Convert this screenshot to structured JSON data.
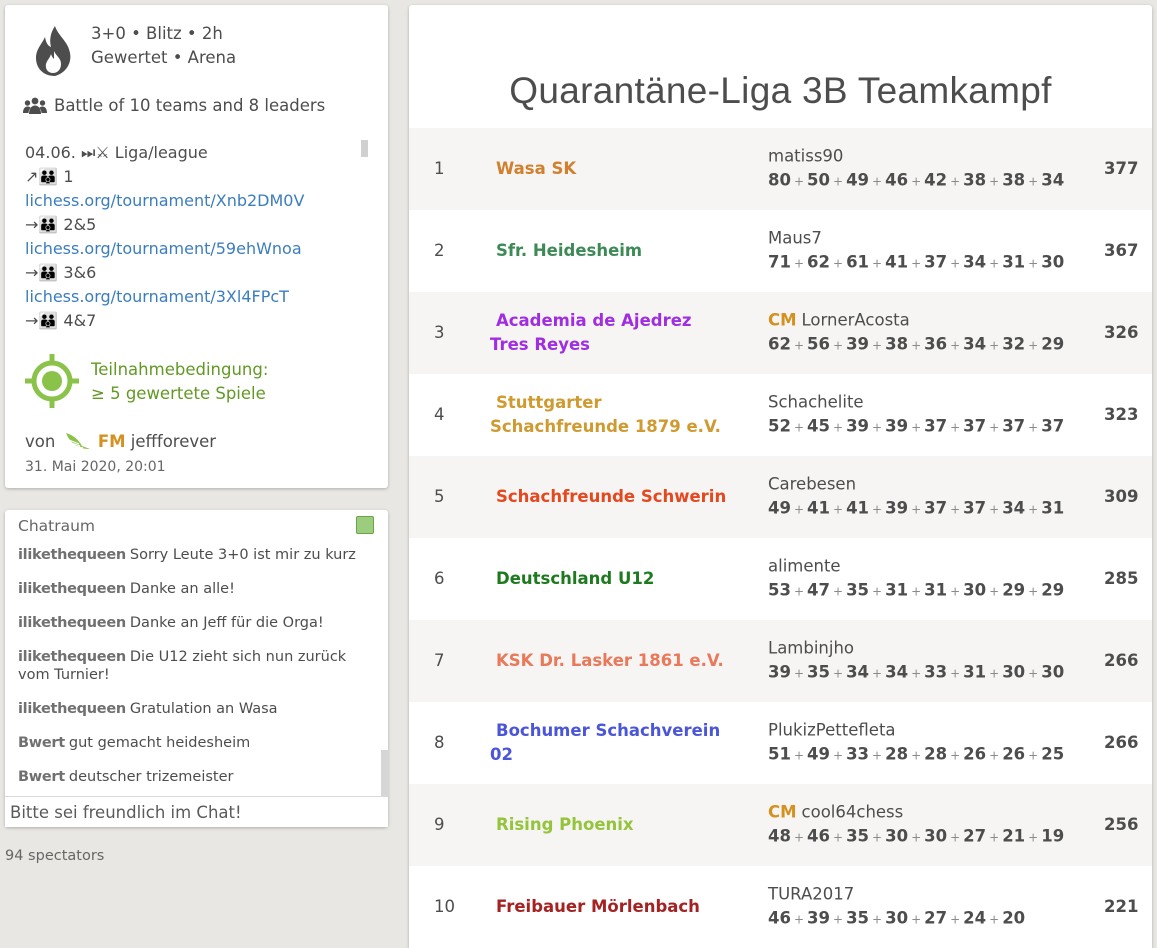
{
  "info": {
    "setup_line1": "3+0 • Blitz • 2h",
    "setup_line2": "Gewertet • Arena",
    "battle": "Battle of 10 teams and 8 leaders",
    "description": [
      {
        "text": "04.06. ⏭⚔ Liga/league",
        "link": false
      },
      {
        "text": "↗👪 1",
        "link": false
      },
      {
        "text": "lichess.org/tournament/Xnb2DM0V",
        "link": true
      },
      {
        "text": "→👪 2&5",
        "link": false
      },
      {
        "text": "lichess.org/tournament/59ehWnoa",
        "link": true
      },
      {
        "text": "→👪 3&6",
        "link": false
      },
      {
        "text": "lichess.org/tournament/3Xl4FPcT",
        "link": true
      },
      {
        "text": "→👪 4&7",
        "link": false
      }
    ],
    "condition_line1": "Teilnahmebedingung:",
    "condition_line2": "≥ 5 gewertete Spiele",
    "by_label": "von",
    "creator_title": "FM",
    "creator_name": "jeffforever",
    "created_date": "31. Mai 2020, 20:01",
    "colors": {
      "condition": "#629924",
      "title": "#d59120",
      "link": "#3b7dbd"
    }
  },
  "chat": {
    "title": "Chatraum",
    "messages": [
      {
        "user": "ilikethequeen",
        "text": "Sorry Leute 3+0 ist mir zu kurz"
      },
      {
        "user": "ilikethequeen",
        "text": "Danke an alle!"
      },
      {
        "user": "ilikethequeen",
        "text": "Danke an Jeff für die Orga!"
      },
      {
        "user": "ilikethequeen",
        "text": "Die U12 zieht sich nun zurück vom Turnier!"
      },
      {
        "user": "ilikethequeen",
        "text": "Gratulation an Wasa"
      },
      {
        "user": "Bwert",
        "text": "gut gemacht heidesheim"
      },
      {
        "user": "Bwert",
        "text": "deutscher trizemeister"
      }
    ],
    "input_placeholder": "Bitte sei freundlich im Chat!"
  },
  "spectators": "94 spectators",
  "main": {
    "title": "Quarantäne-Liga 3B Teamkampf",
    "standings": [
      {
        "rank": "1",
        "team": "Wasa SK",
        "color": "#d0802e",
        "cm": "",
        "leader": "matiss90",
        "scores": [
          "80",
          "50",
          "49",
          "46",
          "42",
          "38",
          "38",
          "34"
        ],
        "total": "377"
      },
      {
        "rank": "2",
        "team": "Sfr. Heidesheim",
        "color": "#3e8a57",
        "cm": "",
        "leader": "Maus7",
        "scores": [
          "71",
          "62",
          "61",
          "41",
          "37",
          "34",
          "31",
          "30"
        ],
        "total": "367"
      },
      {
        "rank": "3",
        "team": "Academia de Ajedrez Tres Reyes",
        "color": "#a02ee0",
        "cm": "CM",
        "leader": "LornerAcosta",
        "scores": [
          "62",
          "56",
          "39",
          "38",
          "36",
          "34",
          "32",
          "29"
        ],
        "total": "326"
      },
      {
        "rank": "4",
        "team": "Stuttgarter Schachfreunde 1879 e.V.",
        "color": "#cf9a30",
        "cm": "",
        "leader": "Schachelite",
        "scores": [
          "52",
          "45",
          "39",
          "39",
          "37",
          "37",
          "37",
          "37"
        ],
        "total": "323"
      },
      {
        "rank": "5",
        "team": "Schachfreunde Schwerin",
        "color": "#e5481f",
        "cm": "",
        "leader": "Carebesen",
        "scores": [
          "49",
          "41",
          "41",
          "39",
          "37",
          "37",
          "34",
          "31"
        ],
        "total": "309"
      },
      {
        "rank": "6",
        "team": "Deutschland U12",
        "color": "#1e7a1e",
        "cm": "",
        "leader": "alimente",
        "scores": [
          "53",
          "47",
          "35",
          "31",
          "31",
          "30",
          "29",
          "29"
        ],
        "total": "285"
      },
      {
        "rank": "7",
        "team": "KSK Dr. Lasker 1861 e.V.",
        "color": "#e8795a",
        "cm": "",
        "leader": "Lambinjho",
        "scores": [
          "39",
          "35",
          "34",
          "34",
          "33",
          "31",
          "30",
          "30"
        ],
        "total": "266"
      },
      {
        "rank": "8",
        "team": "Bochumer Schachverein 02",
        "color": "#4a55d8",
        "cm": "",
        "leader": "PlukizPettefleta",
        "scores": [
          "51",
          "49",
          "33",
          "28",
          "28",
          "26",
          "26",
          "25"
        ],
        "total": "266"
      },
      {
        "rank": "9",
        "team": "Rising Phoenix",
        "color": "#94c43a",
        "cm": "CM",
        "leader": "cool64chess",
        "scores": [
          "48",
          "46",
          "35",
          "30",
          "30",
          "27",
          "21",
          "19"
        ],
        "total": "256"
      },
      {
        "rank": "10",
        "team": "Freibauer Mörlenbach",
        "color": "#a52222",
        "cm": "",
        "leader": "TURA2017",
        "scores": [
          "46",
          "39",
          "35",
          "30",
          "27",
          "24",
          "20"
        ],
        "total": "221"
      }
    ]
  }
}
